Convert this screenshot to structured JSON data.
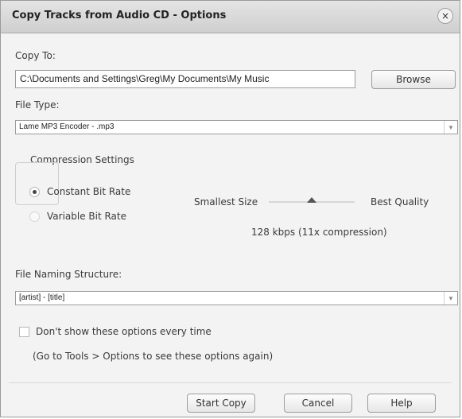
{
  "dialog": {
    "title": "Copy Tracks from Audio CD - Options",
    "close_glyph": "×"
  },
  "copy_to": {
    "label": "Copy To:",
    "path": "C:\\Documents and Settings\\Greg\\My Documents\\My Music",
    "browse_label": "Browse"
  },
  "file_type": {
    "label": "File Type:",
    "selected": "Lame MP3 Encoder - .mp3"
  },
  "compression": {
    "group_label": "Compression Settings",
    "options": [
      {
        "label": "Constant Bit Rate",
        "selected": true
      },
      {
        "label": "Variable Bit Rate",
        "selected": false
      }
    ],
    "slider": {
      "min_label": "Smallest Size",
      "max_label": "Best Quality",
      "level": 0.5,
      "readout": "128 kbps (11x compression)"
    }
  },
  "naming": {
    "label": "File Naming Structure:",
    "selected": "[artist] - [title]"
  },
  "options": {
    "dont_show_label": "Don't show these options every time",
    "dont_show_checked": false,
    "hint": "(Go to Tools > Options to see these options again)"
  },
  "buttons": {
    "start_copy": "Start Copy",
    "cancel": "Cancel",
    "help": "Help"
  },
  "icons": {
    "close": "close-icon",
    "dropdown": "chevron-down-icon",
    "slider_thumb": "triangle-up-icon"
  }
}
